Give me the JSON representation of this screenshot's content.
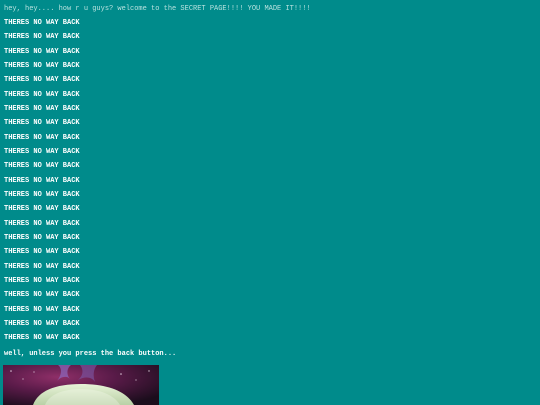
{
  "greeting": "hey, hey.... how r u guys? welcome to the SECRET PAGE!!!! YOU MADE IT!!!!",
  "repeated_lines": [
    "THERES NO WAY BACK",
    "THERES NO WAY BACK",
    "THERES NO WAY BACK",
    "THERES NO WAY BACK",
    "THERES NO WAY BACK",
    "THERES NO WAY BACK",
    "THERES NO WAY BACK",
    "THERES NO WAY BACK",
    "THERES NO WAY BACK",
    "THERES NO WAY BACK",
    "THERES NO WAY BACK",
    "THERES NO WAY BACK",
    "THERES NO WAY BACK",
    "THERES NO WAY BACK",
    "THERES NO WAY BACK",
    "THERES NO WAY BACK",
    "THERES NO WAY BACK",
    "THERES NO WAY BACK",
    "THERES NO WAY BACK",
    "THERES NO WAY BACK",
    "THERES NO WAY BACK",
    "THERES NO WAY BACK",
    "THERES NO WAY BACK"
  ],
  "footer": "well, unless you press the back button...",
  "colors": {
    "background": "#008b8b",
    "text": "#ffffff",
    "greeting_text": "#b8e2df"
  }
}
